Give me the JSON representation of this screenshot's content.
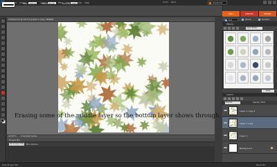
{
  "menubar": {
    "items": [
      "File",
      "Edit",
      "Image",
      "Enhance",
      "Layer",
      "Select",
      "Filter",
      "View",
      "Window",
      "Help"
    ],
    "undo_label": "Undo",
    "redo_label": "Redo",
    "organizer_label": "Organizer"
  },
  "options": {
    "size_label": "Size:",
    "size_value": "100 px",
    "mode_label": "Mode:",
    "mode_value": "Brush",
    "opacity_label": "Opacity:",
    "opacity_value": "100%"
  },
  "document": {
    "title": "Untitled-12 @ 16.7% (Layer 1 copy, RGB/8)",
    "zoom": "16.67%",
    "info": "0 bytes/0 bytes",
    "caption": "Erasing some of the middle layer so the bottom layer shows through."
  },
  "project_bin": {
    "label": "Project Bin",
    "show_select": "Show Open Files",
    "actions_label": "Bin Actions"
  },
  "bottom": {
    "hide_bin": "Hide Project Bin",
    "panel_bin": "Panel Bin"
  },
  "mode_tabs": [
    {
      "label": "EDIT",
      "color": "#e2641c"
    },
    {
      "label": "CREATE",
      "color": "#c33a2b"
    },
    {
      "label": "SHARE",
      "color": "#d25a25"
    }
  ],
  "edit_sub": [
    {
      "label": "Full"
    },
    {
      "label": "Quick"
    },
    {
      "label": "Guided"
    }
  ],
  "effects": {
    "header": "Effects",
    "category": "Layer Styles",
    "apply_label": "Apply",
    "thumbs": [
      {
        "color": "#5f8f3e"
      },
      {
        "color": "#7ea85a"
      },
      {
        "color": "#9ab0c8"
      },
      {
        "color": "#a0a0a0"
      },
      {
        "color": "#6f9a4a"
      },
      {
        "color": "#c9d7b8"
      },
      {
        "color": "#8fa6b8"
      },
      {
        "color": "#b8b8b8"
      },
      {
        "color": "#d8d8d8"
      },
      {
        "color": "#b0b8c8"
      },
      {
        "color": "#3c4c64"
      },
      {
        "color": "#c8c8c8"
      },
      {
        "color": "#e0e4ea"
      },
      {
        "color": "#a8b4c4"
      },
      {
        "color": "#9aa6b8"
      },
      {
        "color": "#c0c8d2"
      }
    ]
  },
  "layers": {
    "header": "Layers",
    "blend_mode": "Normal",
    "opacity": "Opacity: 100%",
    "items": [
      {
        "name": "Layer 1 copy 2",
        "selected": false,
        "thumb": "leaves"
      },
      {
        "name": "Layer 1 copy",
        "selected": true,
        "thumb": "leaves"
      },
      {
        "name": "Layer 1",
        "selected": false,
        "thumb": "leaves"
      },
      {
        "name": "Background",
        "selected": false,
        "thumb": "white"
      }
    ]
  },
  "accent_color": "#e2641c"
}
